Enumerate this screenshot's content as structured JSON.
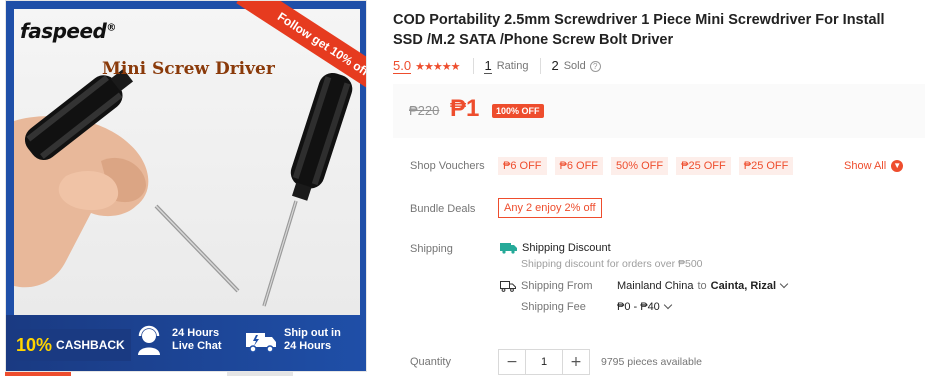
{
  "image": {
    "brand": "faspeed",
    "brand_mark": "®",
    "title": "Mini Screw Driver",
    "ribbon": "Follow get 10% off",
    "cashback_pct": "10%",
    "cashback_word": "CASHBACK",
    "feature1_line1": "24 Hours",
    "feature1_line2": "Live Chat",
    "feature2_line1": "Ship out in",
    "feature2_line2": "24 Hours",
    "colors": {
      "frame": "#1f4fa8",
      "ribbon": "#e63b1f",
      "cashback_pct": "#ffd400"
    }
  },
  "product": {
    "title": "COD Portability 2.5mm Screwdriver 1 Piece Mini Screwdriver For Install SSD /M.2 SATA /Phone Screw Bolt Driver",
    "score": "5.0",
    "stars": 5,
    "rating_count": "1",
    "rating_label": "Rating",
    "sold_count": "2",
    "sold_label": "Sold",
    "old_price": "₱220",
    "new_price": "₱1",
    "discount_badge": "100% OFF"
  },
  "vouchers": {
    "label": "Shop Vouchers",
    "items": [
      "₱6 OFF",
      "₱6 OFF",
      "50% OFF",
      "₱25 OFF",
      "₱25 OFF"
    ],
    "show_all": "Show All"
  },
  "bundle": {
    "label": "Bundle Deals",
    "value": "Any 2 enjoy 2% off"
  },
  "shipping": {
    "label": "Shipping",
    "discount_title": "Shipping Discount",
    "discount_sub": "Shipping discount for orders over ₱500",
    "from_label": "Shipping From",
    "from_value": "Mainland China",
    "to_word": "to",
    "destination": "Cainta, Rizal",
    "fee_label": "Shipping Fee",
    "fee_value": "₱0 - ₱40"
  },
  "quantity": {
    "label": "Quantity",
    "value": "1",
    "minus": "−",
    "plus": "+",
    "available": "9795 pieces available"
  },
  "accent_color": "#ee4d2d"
}
